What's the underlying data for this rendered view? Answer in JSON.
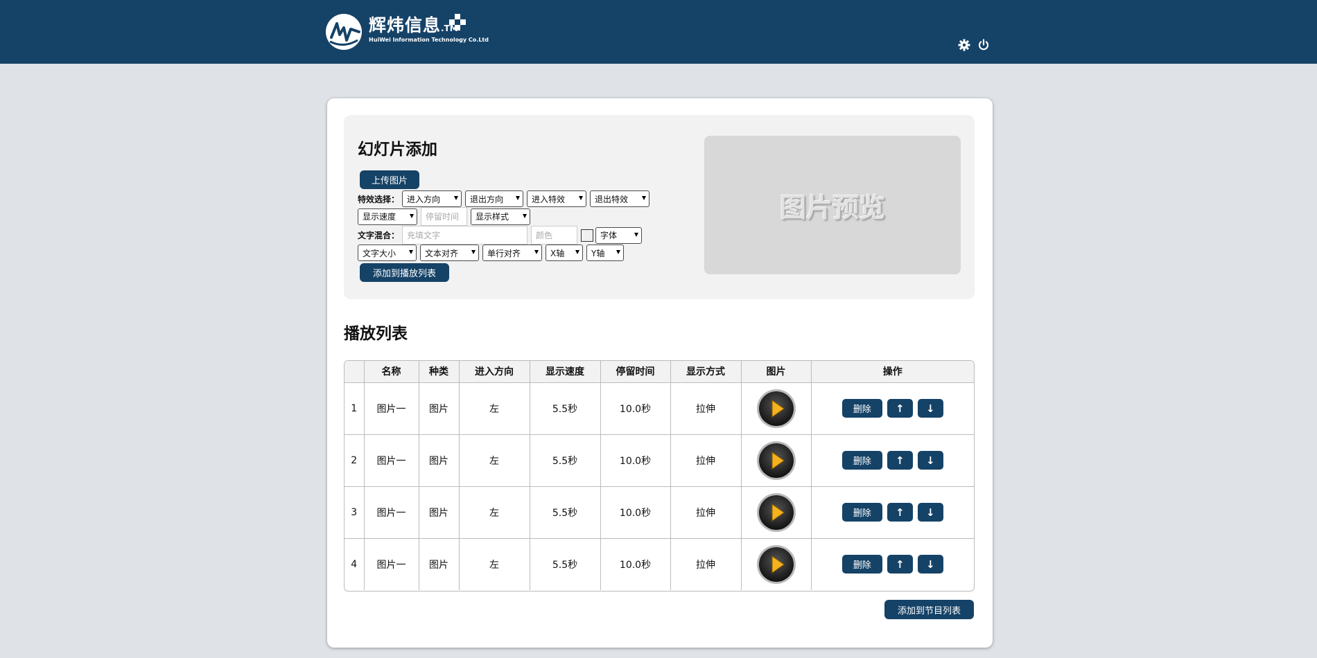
{
  "header": {
    "logo_cn": "辉炜信息",
    "logo_tm": ".TM",
    "logo_en": "HuiWei Information Technology Co.Ltd",
    "icons": [
      "gear-icon",
      "power-icon"
    ]
  },
  "panel": {
    "title": "幻灯片添加",
    "upload_label": "上传图片",
    "effect_label": "特效选择：",
    "selects_row1": [
      "进入方向",
      "退出方向",
      "进入特效",
      "退出特效"
    ],
    "speed_select": "显示速度",
    "stay_placeholder": "停留时间",
    "style_select": "显示样式",
    "text_label": "文字混合：",
    "text_placeholder": "充填文字",
    "color_placeholder": "颜色",
    "font_select": "字体",
    "selects_row4": [
      "文字大小",
      "文本对齐",
      "单行对齐",
      "X轴",
      "Y轴"
    ],
    "add_playlist_label": "添加到播放列表",
    "preview_text": "图片预览"
  },
  "playlist": {
    "title": "播放列表",
    "columns": [
      "",
      "名称",
      "种类",
      "进入方向",
      "显示速度",
      "停留时间",
      "显示方式",
      "图片",
      "操作"
    ],
    "rows": [
      {
        "idx": "1",
        "name": "图片一",
        "kind": "图片",
        "dir": "左",
        "speed": "5.5秒",
        "stay": "10.0秒",
        "mode": "拉伸"
      },
      {
        "idx": "2",
        "name": "图片一",
        "kind": "图片",
        "dir": "左",
        "speed": "5.5秒",
        "stay": "10.0秒",
        "mode": "拉伸"
      },
      {
        "idx": "3",
        "name": "图片一",
        "kind": "图片",
        "dir": "左",
        "speed": "5.5秒",
        "stay": "10.0秒",
        "mode": "拉伸"
      },
      {
        "idx": "4",
        "name": "图片一",
        "kind": "图片",
        "dir": "左",
        "speed": "5.5秒",
        "stay": "10.0秒",
        "mode": "拉伸"
      }
    ],
    "delete_label": "删除",
    "up_label": "↑",
    "down_label": "↓",
    "add_program_label": "添加到节目列表"
  },
  "colors": {
    "brand": "#154267",
    "background": "#dfe2e6",
    "panel": "#f2f2f2"
  }
}
